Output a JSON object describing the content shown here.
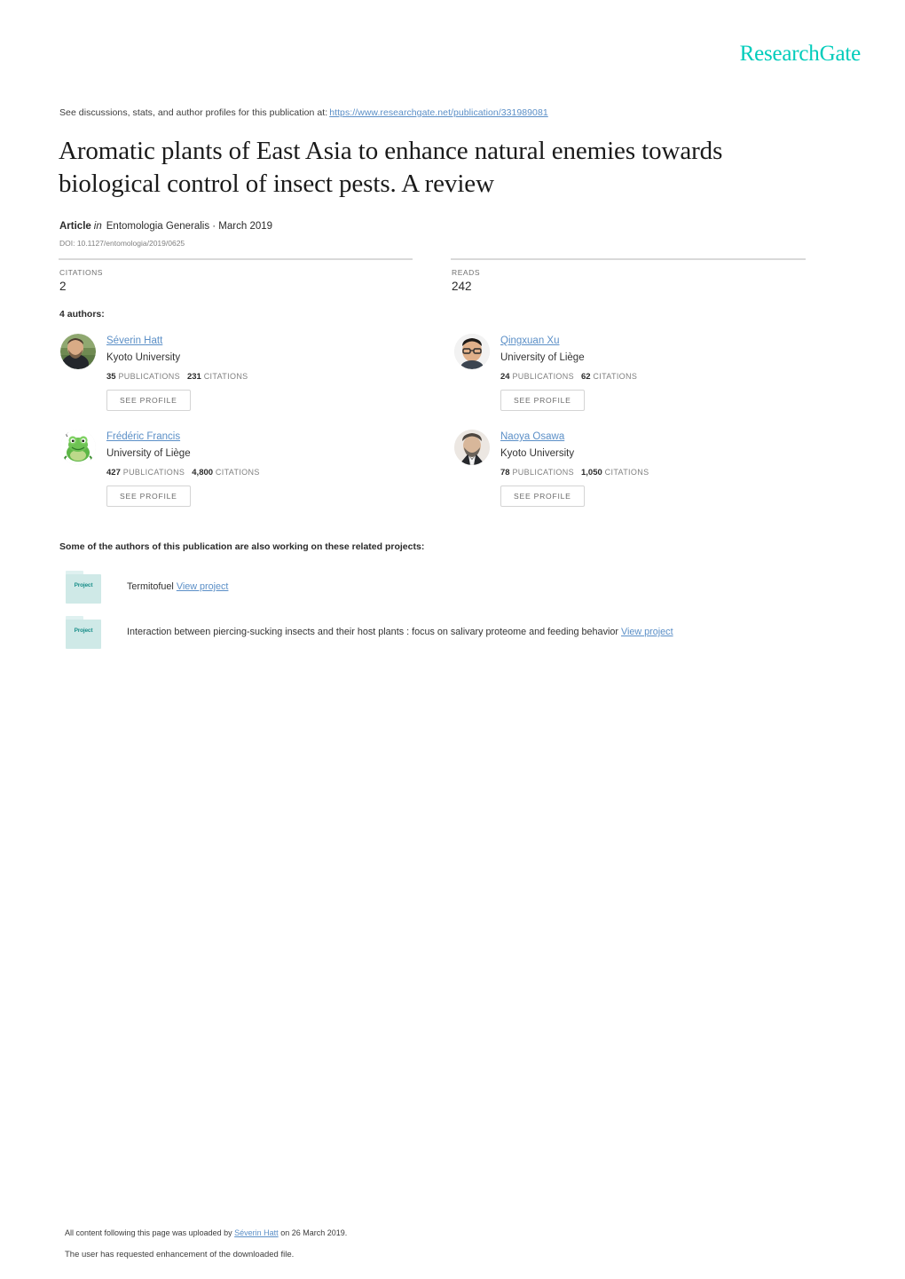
{
  "header": {
    "logo_text": "ResearchGate",
    "logo_color": "#00ccbb"
  },
  "discussions": {
    "prefix": "See discussions, stats, and author profiles for this publication at:",
    "url": "https://www.researchgate.net/publication/331989081"
  },
  "publication": {
    "title": "Aromatic plants of East Asia to enhance natural enemies towards biological control of insect pests. A review",
    "type_label": "Article",
    "in_label": "in",
    "source": "Entomologia Generalis · March 2019",
    "doi": "DOI: 10.1127/entomologia/2019/0625"
  },
  "stats": {
    "citations_label": "CITATIONS",
    "citations_value": "2",
    "reads_label": "READS",
    "reads_value": "242"
  },
  "authors_section": {
    "count_label": "4 authors:",
    "see_profile_label": "SEE PROFILE",
    "publications_label": "PUBLICATIONS",
    "citations_label": "CITATIONS",
    "authors": [
      {
        "name": "Séverin Hatt",
        "affiliation": "Kyoto University",
        "publications": "35",
        "citations": "231",
        "avatar": "photo-bearded-man-outdoors"
      },
      {
        "name": "Qingxuan Xu",
        "affiliation": "University of Liège",
        "publications": "24",
        "citations": "62",
        "avatar": "photo-man-glasses"
      },
      {
        "name": "Frédéric Francis",
        "affiliation": "University of Liège",
        "publications": "427",
        "citations": "4,800",
        "avatar": "cartoon-green-frog"
      },
      {
        "name": "Naoya Osawa",
        "affiliation": "Kyoto University",
        "publications": "78",
        "citations": "1,050",
        "avatar": "photo-man-suit"
      }
    ]
  },
  "projects_section": {
    "heading": "Some of the authors of this publication are also working on these related projects:",
    "icon_label": "Project",
    "view_project_label": "View project",
    "projects": [
      {
        "title": "Termitofuel"
      },
      {
        "title": "Interaction between piercing-sucking insects and their host plants : focus on salivary proteome and feeding behavior"
      }
    ]
  },
  "footer": {
    "upload_prefix": "All content following this page was uploaded by",
    "uploader": "Séverin Hatt",
    "upload_suffix": "on 26 March 2019.",
    "enhancement_note": "The user has requested enhancement of the downloaded file."
  }
}
